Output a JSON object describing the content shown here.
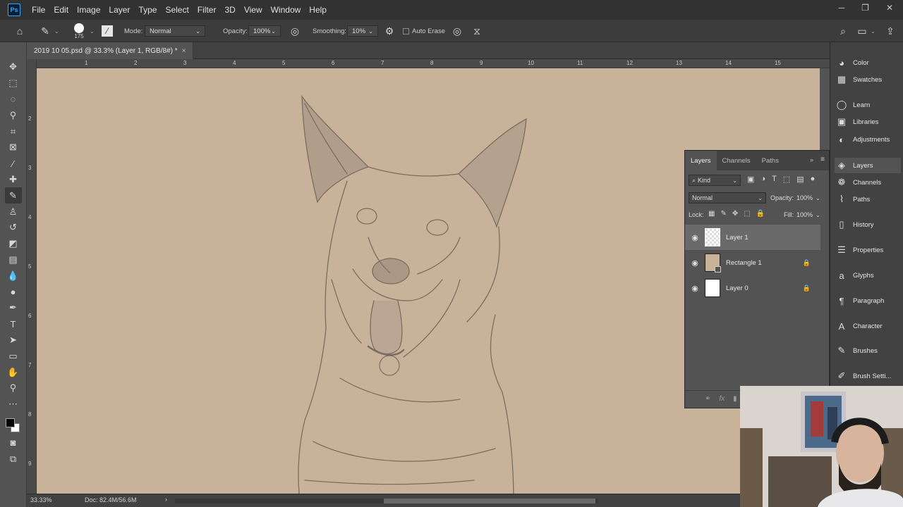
{
  "app": {
    "logo": "Ps"
  },
  "menu": [
    "File",
    "Edit",
    "Image",
    "Layer",
    "Type",
    "Select",
    "Filter",
    "3D",
    "View",
    "Window",
    "Help"
  ],
  "window_controls": [
    "minimize-icon",
    "restore-icon",
    "close-icon"
  ],
  "options": {
    "brush_size": "175",
    "mode_label": "Mode:",
    "mode_value": "Normal",
    "opacity_label": "Opacity:",
    "opacity_value": "100%",
    "smoothing_label": "Smoothing:",
    "smoothing_value": "10%",
    "auto_erase_label": "Auto Erase"
  },
  "document": {
    "tab_title": "2019 10 05.psd @ 33.3% (Layer 1, RGB/8#) *",
    "close": "×",
    "canvas_color": "#c8b29a"
  },
  "rulers": {
    "top": [
      "1",
      "2",
      "3",
      "4",
      "5",
      "6",
      "7",
      "8",
      "9",
      "10",
      "11",
      "12",
      "13",
      "14",
      "15"
    ],
    "left": [
      "2",
      "3",
      "4",
      "5",
      "6",
      "7",
      "8",
      "9"
    ]
  },
  "status": {
    "zoom": "33.33%",
    "doc": "Doc: 82.4M/56.6M",
    "arrow": "›"
  },
  "dock": [
    {
      "label": "Color",
      "icon": "color-icon",
      "glyph": "◕"
    },
    {
      "label": "Swatches",
      "icon": "swatches-icon",
      "glyph": "▦"
    },
    {
      "label": "Learn",
      "icon": "learn-icon",
      "glyph": "◯"
    },
    {
      "label": "Libraries",
      "icon": "libraries-icon",
      "glyph": "▣"
    },
    {
      "label": "Adjustments",
      "icon": "adjustments-icon",
      "glyph": "◐"
    },
    {
      "label": "Layers",
      "icon": "layers-icon",
      "glyph": "◈"
    },
    {
      "label": "Channels",
      "icon": "channels-icon",
      "glyph": "❁"
    },
    {
      "label": "Paths",
      "icon": "paths-icon",
      "glyph": "⌇"
    },
    {
      "label": "History",
      "icon": "history-icon",
      "glyph": "▯"
    },
    {
      "label": "Properties",
      "icon": "properties-icon",
      "glyph": "☰"
    },
    {
      "label": "Glyphs",
      "icon": "glyphs-icon",
      "glyph": "a"
    },
    {
      "label": "Paragraph",
      "icon": "paragraph-icon",
      "glyph": "¶"
    },
    {
      "label": "Character",
      "icon": "character-icon",
      "glyph": "A"
    },
    {
      "label": "Brushes",
      "icon": "brushes-icon",
      "glyph": "✎"
    },
    {
      "label": "Brush Setti...",
      "icon": "brush-settings-icon",
      "glyph": "✐"
    }
  ],
  "layers_panel": {
    "tabs": [
      "Layers",
      "Channels",
      "Paths"
    ],
    "kind_label": "Kind",
    "blend_mode": "Normal",
    "opacity_label": "Opacity:",
    "opacity_value": "100%",
    "lock_label": "Lock:",
    "fill_label": "Fill:",
    "fill_value": "100%",
    "layers": [
      {
        "name": "Layer 1",
        "selected": true,
        "locked": false,
        "thumb": "transparent"
      },
      {
        "name": "Rectangle 1",
        "selected": false,
        "locked": true,
        "thumb": "#c8b29a"
      },
      {
        "name": "Layer 0",
        "selected": false,
        "locked": true,
        "thumb": "#ffffff"
      }
    ],
    "footer_fx": "fx"
  }
}
